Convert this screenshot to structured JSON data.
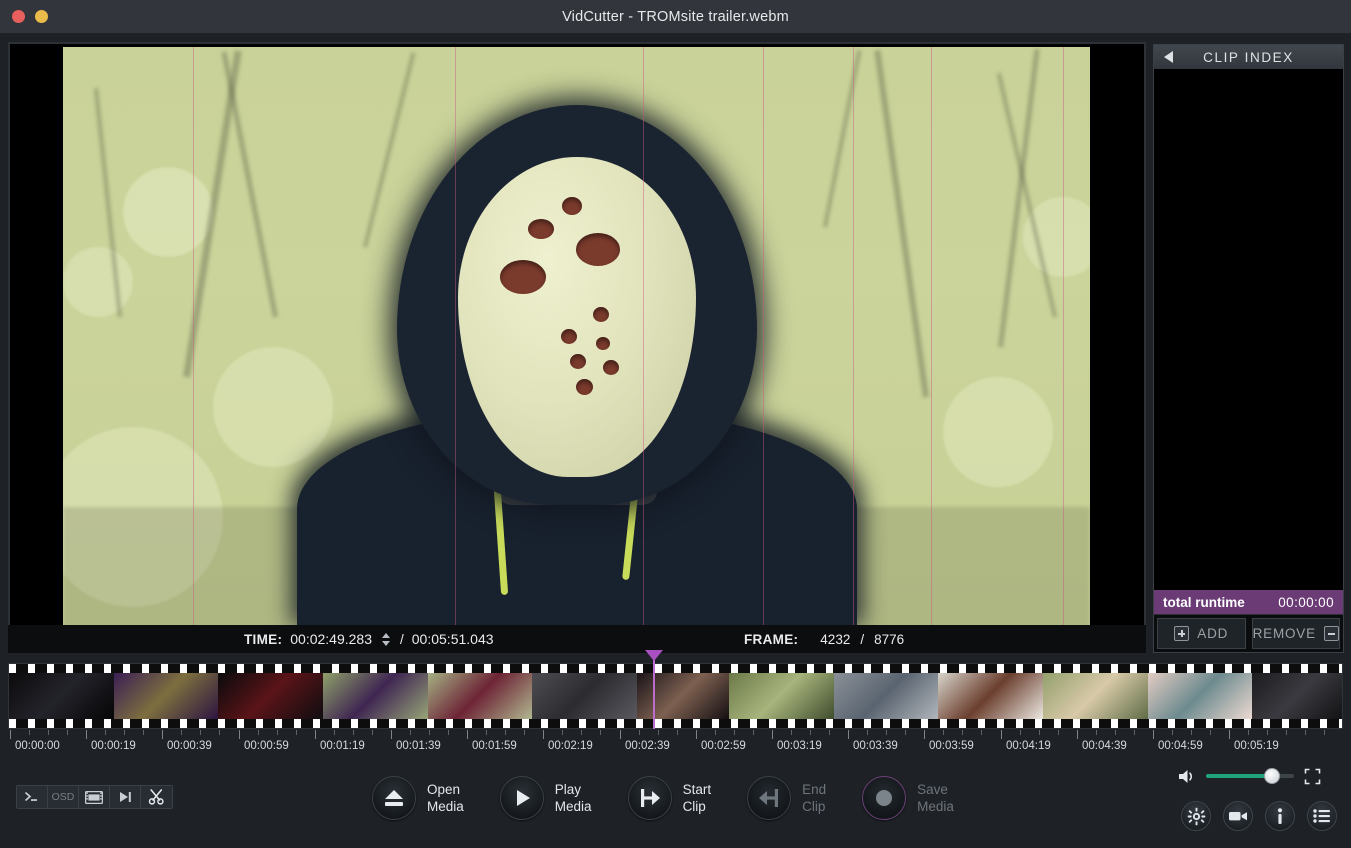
{
  "window": {
    "title": "VidCutter - TROMsite trailer.webm",
    "app_name": "VidCutter",
    "file_name": "TROMsite trailer.webm",
    "close_button": "close-button",
    "minimize_button": "minimize-button"
  },
  "timebar": {
    "time_label": "TIME:",
    "current_time": "00:02:49.283",
    "separator": "/",
    "total_time": "00:05:51.043",
    "frame_label": "FRAME:",
    "current_frame": "4232",
    "frame_separator": "/",
    "total_frames": "8776"
  },
  "clip_index": {
    "header": "CLIP INDEX",
    "collapse_icon": "left-triangle-icon",
    "runtime_label": "total runtime",
    "runtime_value": "00:00:00",
    "add_label": "ADD",
    "remove_label": "REMOVE",
    "clips": []
  },
  "toolbar_left": [
    {
      "name": "console-button",
      "label": ">_",
      "enabled": true
    },
    {
      "name": "osd-button",
      "label": "OSD",
      "enabled": false
    },
    {
      "name": "thumbnails-button",
      "label": "filmstrip-icon",
      "enabled": true
    },
    {
      "name": "frame-step-button",
      "label": "step-forward-icon",
      "enabled": true
    },
    {
      "name": "cut-button",
      "label": "scissors-icon",
      "enabled": true
    }
  ],
  "main_actions": [
    {
      "name": "open-media",
      "line1": "Open",
      "line2": "Media",
      "icon": "eject-icon",
      "enabled": true
    },
    {
      "name": "play-media",
      "line1": "Play",
      "line2": "Media",
      "icon": "play-icon",
      "enabled": true
    },
    {
      "name": "start-clip",
      "line1": "Start",
      "line2": "Clip",
      "icon": "clip-start-icon",
      "enabled": true
    },
    {
      "name": "end-clip",
      "line1": "End",
      "line2": "Clip",
      "icon": "clip-end-icon",
      "enabled": false
    },
    {
      "name": "save-media",
      "line1": "Save",
      "line2": "Media",
      "icon": "record-icon",
      "enabled": false
    }
  ],
  "toolbar_right": {
    "volume_icon": "speaker-icon",
    "volume_percent": 75,
    "fullscreen_icon": "fullscreen-icon",
    "buttons": [
      {
        "name": "settings-button",
        "icon": "gear-icon"
      },
      {
        "name": "media-stream-button",
        "icon": "video-camera-icon"
      },
      {
        "name": "media-info-button",
        "icon": "info-icon"
      },
      {
        "name": "clip-index-toggle-button",
        "icon": "list-icon"
      }
    ]
  },
  "timeline": {
    "playhead_position_percent": 48.3,
    "playhead_time": "00:02:49.283",
    "ticks": [
      "00:00:00",
      "00:00:19",
      "00:00:39",
      "00:00:59",
      "00:01:19",
      "00:01:39",
      "00:01:59",
      "00:02:19",
      "00:02:39",
      "00:02:59",
      "00:03:19",
      "00:03:39",
      "00:03:59",
      "00:04:19",
      "00:04:39",
      "00:04:59",
      "00:05:19"
    ],
    "thumbnails": [
      {
        "name": "dark-lens",
        "width": 105,
        "c1": "#0b0b0d",
        "c2": "#23232a",
        "c3": "#050506"
      },
      {
        "name": "purple-figure",
        "width": 105,
        "c1": "#3b1f55",
        "c2": "#7d6f3f",
        "c3": "#2a1240"
      },
      {
        "name": "dark-red-ui",
        "width": 105,
        "c1": "#0a0a0c",
        "c2": "#5a1418",
        "c3": "#0d0d10"
      },
      {
        "name": "water-ship-1",
        "width": 105,
        "c1": "#8fa06a",
        "c2": "#3f2652",
        "c3": "#9aa878"
      },
      {
        "name": "water-ship-2",
        "width": 105,
        "c1": "#a5b184",
        "c2": "#6d2436",
        "c3": "#b2bb92"
      },
      {
        "name": "crowd-map",
        "width": 105,
        "c1": "#4e4e52",
        "c2": "#2b2b30",
        "c3": "#5a5a60"
      },
      {
        "name": "woman-dark",
        "width": 92,
        "c1": "#1b1419",
        "c2": "#7d6050",
        "c3": "#120d11"
      },
      {
        "name": "forest-green",
        "width": 105,
        "c1": "#6c7a4a",
        "c2": "#a7b47c",
        "c3": "#3d4a2b"
      },
      {
        "name": "indoor-blue",
        "width": 105,
        "c1": "#8a9097",
        "c2": "#5a6470",
        "c3": "#b3b8bd"
      },
      {
        "name": "trom-posters",
        "width": 105,
        "c1": "#d8d4cc",
        "c2": "#6b3f2e",
        "c3": "#efece6"
      },
      {
        "name": "children",
        "width": 105,
        "c1": "#93a06d",
        "c2": "#d8c9a8",
        "c3": "#5c6a44"
      },
      {
        "name": "eye-closeup",
        "width": 105,
        "c1": "#e3ccc4",
        "c2": "#6d8a8e",
        "c3": "#f0dcd4"
      },
      {
        "name": "webpage",
        "width": 92,
        "c1": "#1d1d20",
        "c2": "#3a3a40",
        "c3": "#111113"
      }
    ]
  },
  "video": {
    "scene": "masked-figure-in-hoodie",
    "background": "#c9d298"
  }
}
